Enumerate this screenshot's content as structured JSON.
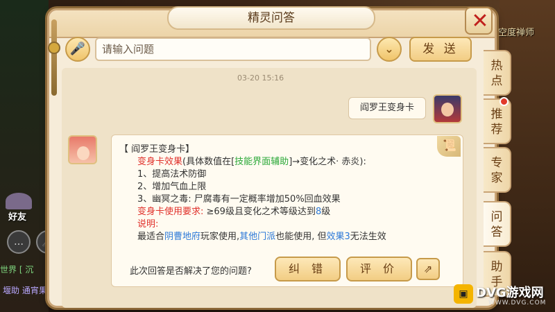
{
  "window": {
    "title": "精灵问答"
  },
  "background": {
    "top_right_label": "空度禅师",
    "friend_label": "好友",
    "world_chat": "世界 [  沉",
    "world_chat_2": "堰助  通宵果"
  },
  "input": {
    "placeholder": "请输入问题",
    "send_label": "发 送"
  },
  "chat": {
    "timestamp": "03-20 15:16",
    "user_message": "阎罗王变身卡",
    "answer": {
      "title": "【 阎罗王变身卡】",
      "effect_label": "变身卡效果",
      "effect_intro_a": "(具体数值在[",
      "effect_intro_link": "技能界面辅助",
      "effect_intro_b": "]→变化之术· 赤炎):",
      "item_1": "1、提高法术防御",
      "item_2": "2、增加气血上限",
      "item_3": "3、幽冥之毒: 尸腐毒有一定概率增加50%回血效果",
      "req_label": "变身卡使用要求:",
      "req_text_a": " ≥69级且变化之术等级达到",
      "req_level": "8",
      "req_text_b": "级",
      "note_label": "说明:",
      "note_a": "最适合",
      "note_school": "阴曹地府",
      "note_b": "玩家使用,",
      "note_other": "其他门派",
      "note_c": "也能使用, 但",
      "note_effect": "效果3",
      "note_d": "无法生效"
    }
  },
  "feedback": {
    "question": "此次回答是否解决了您的问题?",
    "fix_label": "纠 错",
    "rate_label": "评 价"
  },
  "tabs": [
    {
      "label_1": "热",
      "label_2": "点"
    },
    {
      "label_1": "推",
      "label_2": "荐"
    },
    {
      "label_1": "专",
      "label_2": "家"
    },
    {
      "label_1": "问",
      "label_2": "答"
    },
    {
      "label_1": "助",
      "label_2": "手"
    }
  ],
  "watermark": {
    "text": "DVG游戏网",
    "url": "WWW.DVG.COM"
  },
  "colors": {
    "highlight_red": "#e0302a",
    "link_green": "#2aa838",
    "accent_blue": "#2a78d8",
    "panel_bg": "#f6ecd9"
  }
}
